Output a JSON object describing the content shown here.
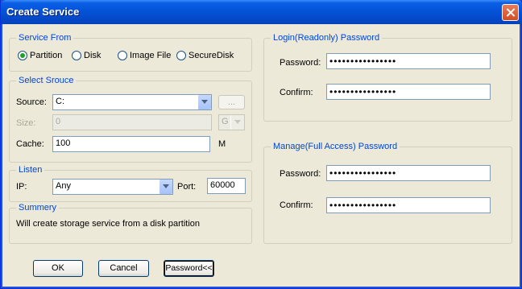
{
  "window": {
    "title": "Create Service"
  },
  "service_from": {
    "legend": "Service From",
    "options": [
      {
        "label": "Partition",
        "checked": true
      },
      {
        "label": "Disk",
        "checked": false
      },
      {
        "label": "Image File",
        "checked": false
      },
      {
        "label": "SecureDisk",
        "checked": false
      }
    ]
  },
  "select_source": {
    "legend": "Select Srouce",
    "source_label": "Source:",
    "source_value": "C:",
    "browse_label": "...",
    "size_label": "Size:",
    "size_value": "0",
    "size_unit": "G",
    "cache_label": "Cache:",
    "cache_value": "100",
    "cache_unit": "M"
  },
  "listen": {
    "legend": "Listen",
    "ip_label": "IP:",
    "ip_value": "Any",
    "port_label": "Port:",
    "port_value": "60000"
  },
  "summary": {
    "legend": "Summery",
    "text": "Will create storage service from a disk partition"
  },
  "login_password": {
    "legend": "Login(Readonly) Password",
    "password_label": "Password:",
    "password_value": "••••••••••••••••",
    "confirm_label": "Confirm:",
    "confirm_value": "••••••••••••••••"
  },
  "manage_password": {
    "legend": "Manage(Full Access) Password",
    "password_label": "Password:",
    "password_value": "••••••••••••••••",
    "confirm_label": "Confirm:",
    "confirm_value": "••••••••••••••••"
  },
  "buttons": {
    "ok": "OK",
    "cancel": "Cancel",
    "password_toggle": "Password<<"
  }
}
